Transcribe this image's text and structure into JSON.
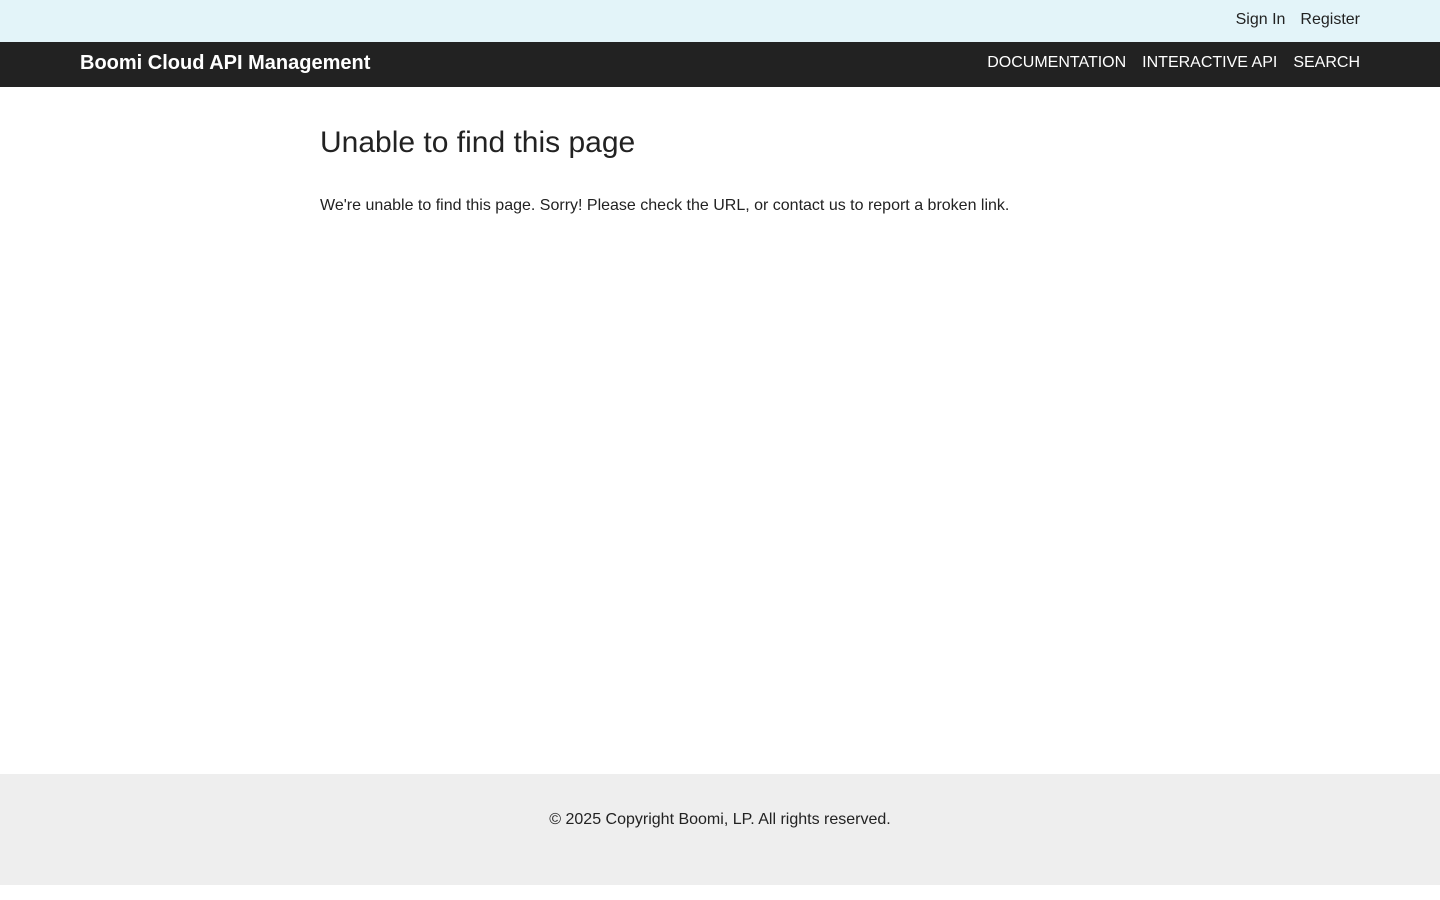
{
  "utility": {
    "sign_in": "Sign In",
    "register": "Register"
  },
  "nav": {
    "brand": "Boomi Cloud API Management",
    "items": [
      {
        "label": "DOCUMENTATION"
      },
      {
        "label": "INTERACTIVE API"
      },
      {
        "label": "SEARCH"
      }
    ]
  },
  "main": {
    "title": "Unable to find this page",
    "message_before": "We're unable to find this page. Sorry! Please check the URL, or ",
    "contact_link": "contact us",
    "message_after": " to report a broken link."
  },
  "footer": {
    "copyright": "© 2025 Copyright Boomi, LP. All rights reserved."
  },
  "colors": {
    "utility_bar_bg": "#e3f4f9",
    "nav_bar_bg": "#222222",
    "footer_bg": "#eeeeee",
    "text": "#222222"
  }
}
